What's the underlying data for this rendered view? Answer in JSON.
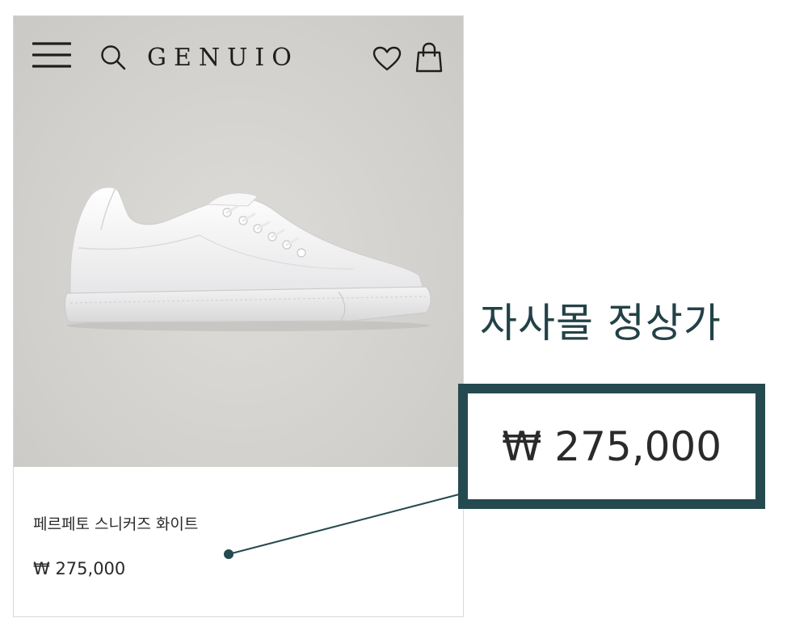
{
  "header": {
    "logo": "GENUIO",
    "icons": [
      "menu-icon",
      "search-icon",
      "heart-icon",
      "bag-icon"
    ]
  },
  "product": {
    "name": "페르페토 스니커즈 화이트",
    "price": "₩ 275,000",
    "image": "white-leather-sneaker"
  },
  "callout": {
    "title": "자사몰 정상가",
    "price": "₩ 275,000"
  },
  "colors": {
    "accent": "#244a4f",
    "hero_background": "#d3d1cd",
    "text": "#2a2a2a"
  }
}
